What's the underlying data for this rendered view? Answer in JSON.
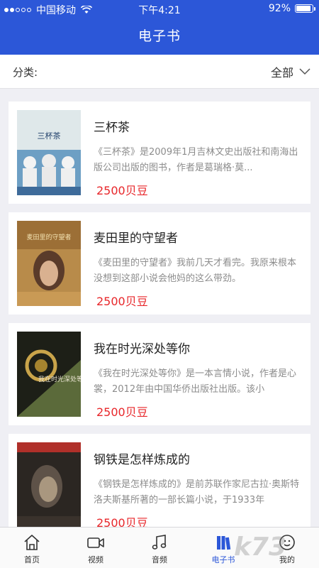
{
  "status_bar": {
    "carrier": "中国移动",
    "time": "下午4:21",
    "battery": "92%",
    "battery_level": 0.92
  },
  "header": {
    "title": "电子书"
  },
  "filter": {
    "label": "分类:",
    "selected": "全部"
  },
  "books": [
    {
      "title": "三杯茶",
      "description": "《三杯茶》是2009年1月吉林文史出版社和南海出版公司出版的图书，作者是葛瑞格·莫...",
      "price": "2500贝豆",
      "cover_text": "三杯茶"
    },
    {
      "title": "麦田里的守望者",
      "description": "《麦田里的守望者》我前几天才看完。我原来根本没想到这部小说会他妈的这么带劲。",
      "price": "2500贝豆",
      "cover_text": "麦田里的守望者"
    },
    {
      "title": "我在时光深处等你",
      "description": "《我在时光深处等你》是一本言情小说，作者是心裳，2012年由中国华侨出版社出版。该小",
      "price": "2500贝豆",
      "cover_text": "我在时光深处等你"
    },
    {
      "title": "钢铁是怎样炼成的",
      "description": "《钢铁是怎样炼成的》是前苏联作家尼古拉·奥斯特洛夫斯基所著的一部长篇小说，于1933年",
      "price": "2500贝豆",
      "cover_text": ""
    }
  ],
  "tabs": [
    {
      "label": "首页",
      "icon": "home-icon"
    },
    {
      "label": "视频",
      "icon": "video-icon"
    },
    {
      "label": "音频",
      "icon": "music-icon"
    },
    {
      "label": "电子书",
      "icon": "book-icon",
      "active": true
    },
    {
      "label": "我的",
      "icon": "profile-icon"
    }
  ],
  "watermark": "k73",
  "colors": {
    "header": "#2c57d8",
    "price": "#e8262a",
    "active_tab": "#2c57d8"
  }
}
